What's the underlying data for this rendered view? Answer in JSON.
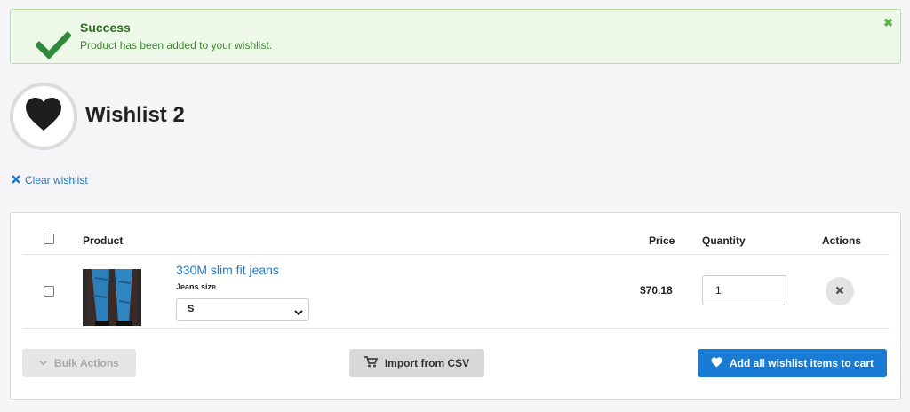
{
  "alert": {
    "title": "Success",
    "message": "Product has been added to your wishlist.",
    "close_glyph": "✖",
    "icons": [
      "check-icon",
      "close-icon"
    ],
    "color": "#2e6b22"
  },
  "header": {
    "title": "Wishlist 2",
    "icon": "heart-icon"
  },
  "clear_link": {
    "label": "Clear wishlist",
    "icon": "close-icon"
  },
  "table": {
    "columns": {
      "product": "Product",
      "price": "Price",
      "quantity": "Quantity",
      "actions": "Actions"
    },
    "rows": [
      {
        "product_name": "330M slim fit jeans",
        "option_label": "Jeans size",
        "option_value": "S",
        "price": "$70.18",
        "quantity": "1"
      }
    ]
  },
  "footer": {
    "bulk_actions": "Bulk Actions",
    "import_csv": "Import from CSV",
    "add_all": "Add all wishlist items to cart"
  },
  "colors": {
    "link": "#1f78c8",
    "primary_button": "#1a7bd4",
    "success_bg": "#eef8e9"
  }
}
